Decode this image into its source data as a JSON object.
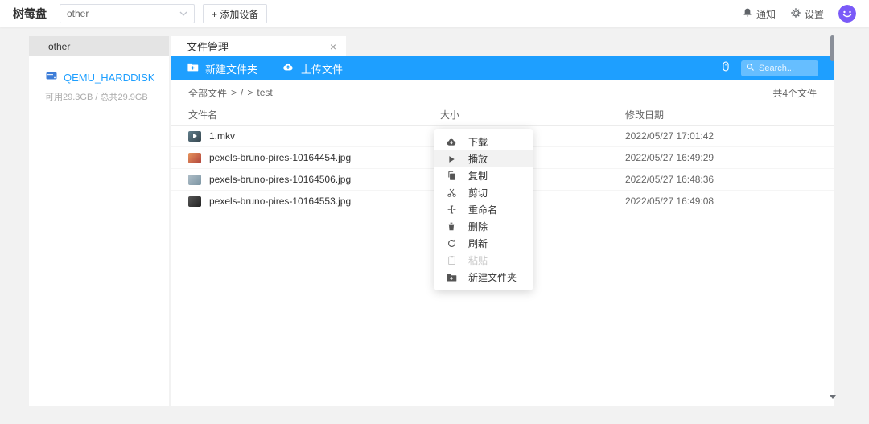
{
  "topbar": {
    "app_title": "树莓盘",
    "device_select_value": "other",
    "add_device_label": "+ 添加设备",
    "notifications_label": "通知",
    "settings_label": "设置"
  },
  "sidebar": {
    "tab_label": "other",
    "disk_name": "QEMU_HARDDISK",
    "disk_capacity": "可用29.3GB / 总共29.9GB"
  },
  "filetab": {
    "label": "文件管理",
    "close": "×"
  },
  "toolbar": {
    "new_folder_label": "新建文件夹",
    "new_folder_icon": "folder-plus-icon",
    "upload_label": "上传文件",
    "upload_icon": "cloud-upload-icon",
    "mouse_icon": "mouse-icon",
    "search_icon": "search-icon",
    "search_placeholder": "Search..."
  },
  "breadcrumb": {
    "root": "全部文件",
    "sep": ">",
    "path": "/",
    "current": "test",
    "file_count": "共4个文件"
  },
  "table": {
    "headers": {
      "name": "文件名",
      "size": "大小",
      "date": "修改日期"
    },
    "rows": [
      {
        "name": "1.mkv",
        "type": "video",
        "date": "2022/05/27 17:01:42"
      },
      {
        "name": "pexels-bruno-pires-10164454.jpg",
        "type": "image",
        "date": "2022/05/27 16:49:29"
      },
      {
        "name": "pexels-bruno-pires-10164506.jpg",
        "type": "image",
        "date": "2022/05/27 16:48:36"
      },
      {
        "name": "pexels-bruno-pires-10164553.jpg",
        "type": "image",
        "date": "2022/05/27 16:49:08"
      }
    ]
  },
  "context_menu": {
    "items": [
      {
        "label": "下载",
        "icon": "cloud-download-icon",
        "disabled": false
      },
      {
        "label": "播放",
        "icon": "play-icon",
        "disabled": false,
        "hovered": true
      },
      {
        "label": "复制",
        "icon": "copy-icon",
        "disabled": false
      },
      {
        "label": "剪切",
        "icon": "cut-icon",
        "disabled": false
      },
      {
        "label": "重命名",
        "icon": "rename-icon",
        "disabled": false
      },
      {
        "label": "删除",
        "icon": "delete-icon",
        "disabled": false
      },
      {
        "label": "刷新",
        "icon": "refresh-icon",
        "disabled": false
      },
      {
        "label": "粘贴",
        "icon": "paste-icon",
        "disabled": true
      },
      {
        "label": "新建文件夹",
        "icon": "new-folder-icon",
        "disabled": false
      }
    ]
  },
  "colors": {
    "accent": "#1E9FFF",
    "avatar": "#7A5AF8"
  }
}
